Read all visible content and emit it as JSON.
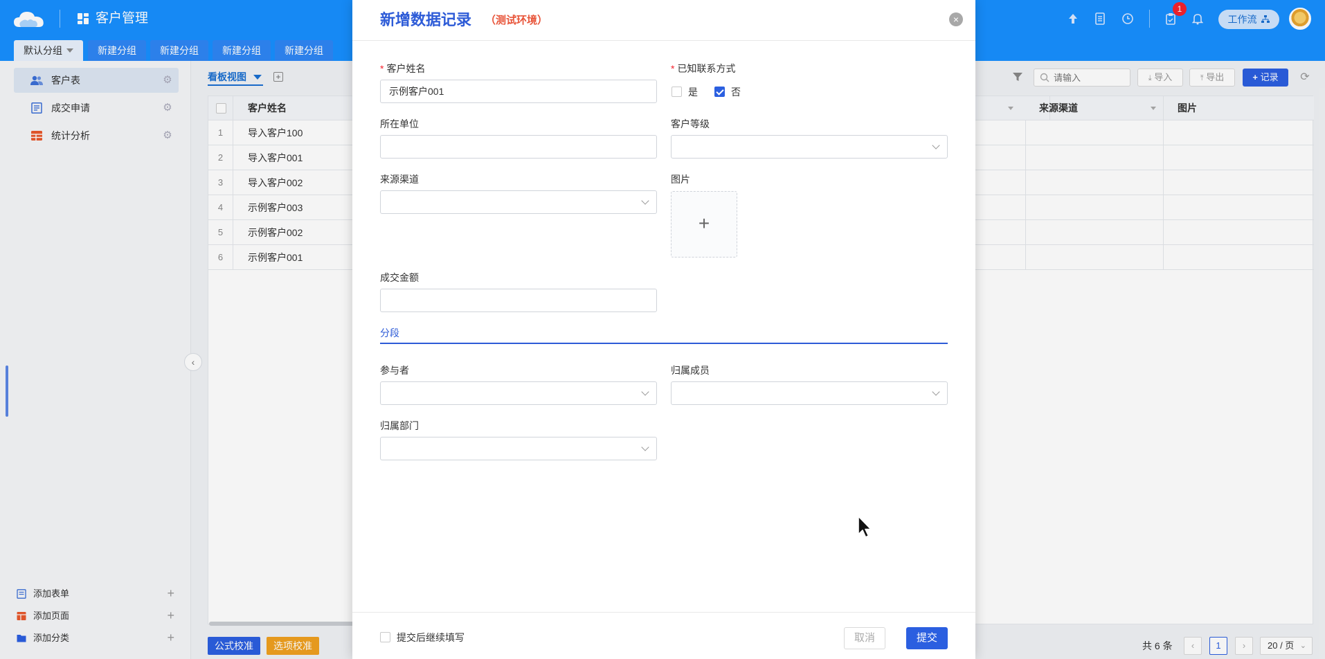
{
  "app": {
    "title": "客户管理"
  },
  "topbar": {
    "notification_count": "1",
    "workflow_label": "工作流"
  },
  "group_tabs": [
    {
      "label": "默认分组",
      "active": true
    },
    {
      "label": "新建分组"
    },
    {
      "label": "新建分组"
    },
    {
      "label": "新建分组"
    },
    {
      "label": "新建分组"
    }
  ],
  "sidebar": {
    "items": [
      {
        "label": "客户表",
        "icon": "users-icon",
        "active": true
      },
      {
        "label": "成交申请",
        "icon": "form-icon"
      },
      {
        "label": "统计分析",
        "icon": "table-chart-icon"
      }
    ],
    "bottom": [
      {
        "label": "添加表单",
        "icon": "form-icon"
      },
      {
        "label": "添加页面",
        "icon": "page-icon"
      },
      {
        "label": "添加分类",
        "icon": "folder-icon"
      }
    ]
  },
  "view": {
    "label": "看板视图"
  },
  "toolbar": {
    "search_placeholder": "请输入",
    "import_label": "导入",
    "export_label": "导出",
    "record_label": "记录"
  },
  "table": {
    "columns": [
      "客户姓名",
      "来源渠道",
      "图片"
    ],
    "rows": [
      {
        "index": "1",
        "name": "导入客户100"
      },
      {
        "index": "2",
        "name": "导入客户001"
      },
      {
        "index": "3",
        "name": "导入客户002"
      },
      {
        "index": "4",
        "name": "示例客户003"
      },
      {
        "index": "5",
        "name": "示例客户002"
      },
      {
        "index": "6",
        "name": "示例客户001"
      }
    ]
  },
  "footer": {
    "formula_check": "公式校准",
    "option_check": "选项校准",
    "total": "共 6 条",
    "current_page": "1",
    "page_size": "20 / 页"
  },
  "modal": {
    "title": "新增数据记录",
    "env": "（测试环境）",
    "fields": {
      "customer_name": {
        "label": "客户姓名",
        "value": "示例客户001",
        "required": true
      },
      "known_contact": {
        "label": "已知联系方式",
        "required": true,
        "options": [
          "是",
          "否"
        ],
        "selected": "否"
      },
      "company": {
        "label": "所在单位",
        "value": ""
      },
      "customer_level": {
        "label": "客户等级",
        "value": ""
      },
      "source_channel": {
        "label": "来源渠道",
        "value": ""
      },
      "picture": {
        "label": "图片"
      },
      "deal_amount": {
        "label": "成交金额",
        "value": ""
      },
      "participants": {
        "label": "参与者",
        "value": ""
      },
      "owner_member": {
        "label": "归属成员",
        "value": ""
      },
      "owner_department": {
        "label": "归属部门",
        "value": ""
      }
    },
    "section": "分段",
    "continue_label": "提交后继续填写",
    "cancel_label": "取消",
    "submit_label": "提交"
  },
  "colors": {
    "topbar": "#1890ff",
    "primary": "#2b5fe0",
    "title_blue": "#2d5bd7",
    "env_red": "#e8553a",
    "formula_btn": "#2b5fe0",
    "option_btn": "#f0a020"
  }
}
